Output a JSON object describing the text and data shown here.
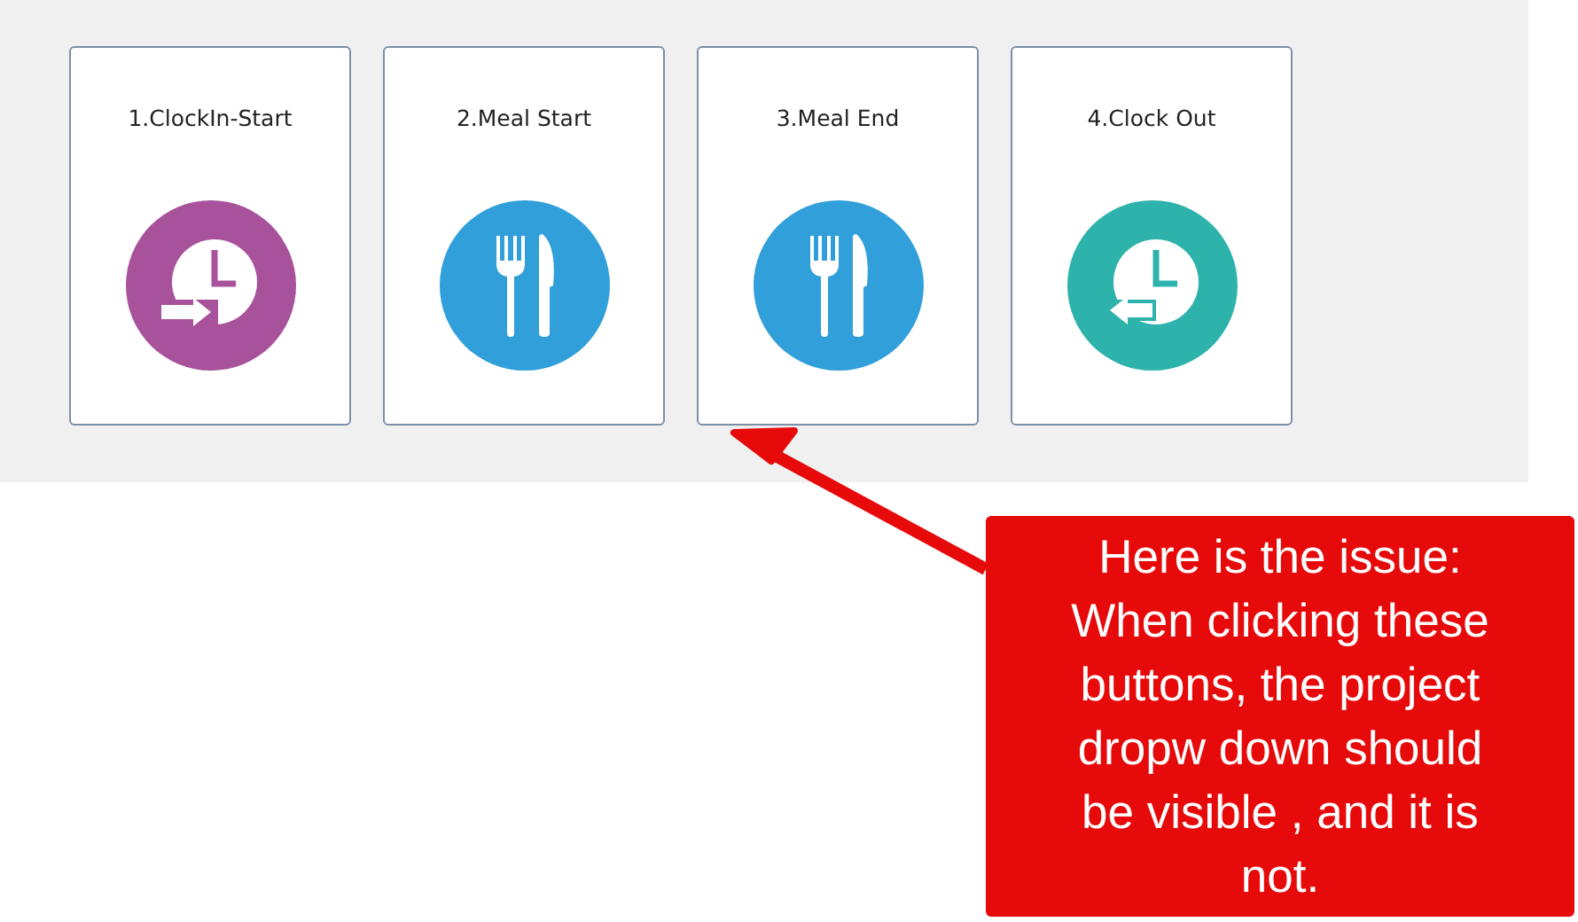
{
  "cards": [
    {
      "title": "1.ClockIn-Start",
      "kind": "clock-in",
      "color": "#a8529c"
    },
    {
      "title": "2.Meal Start",
      "kind": "meal",
      "color": "#309fda"
    },
    {
      "title": "3.Meal End",
      "kind": "meal",
      "color": "#309fda"
    },
    {
      "title": "4.Clock Out",
      "kind": "clock-out",
      "color": "#2db3ab"
    }
  ],
  "callout": {
    "text": "Here is the issue:\nWhen clicking these\nbuttons, the project\ndropw down should\nbe visible , and it is\nnot."
  }
}
